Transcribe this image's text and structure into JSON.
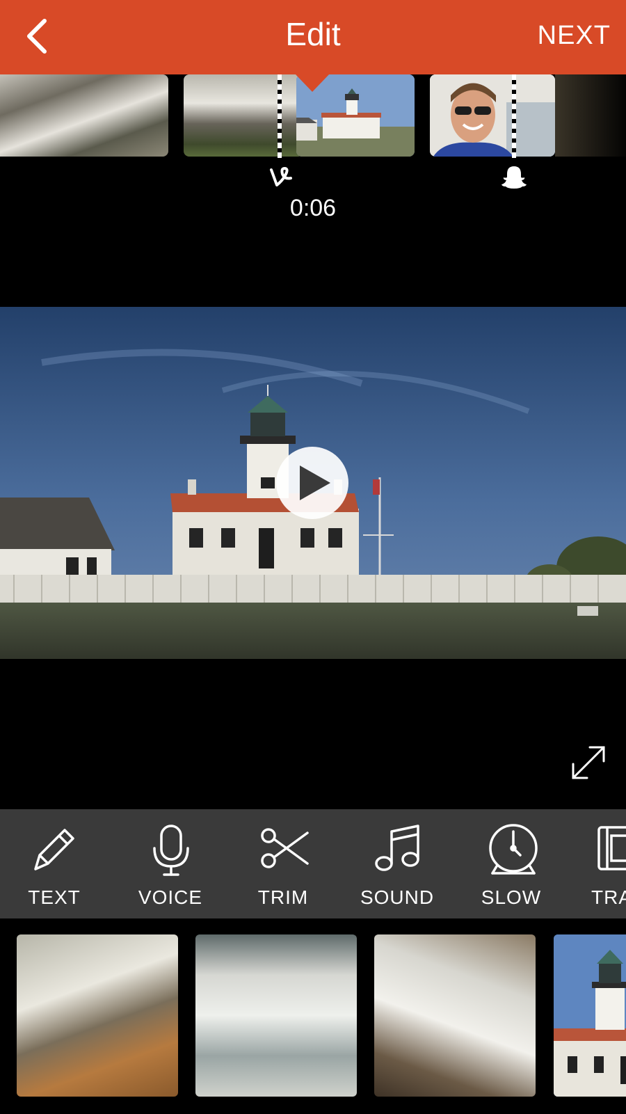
{
  "header": {
    "title": "Edit",
    "next_label": "NEXT",
    "back_icon": "chevron-left-icon",
    "color": "#d84a27"
  },
  "timeline": {
    "timecode": "0:06",
    "clips": [
      "clip-rocky-shore",
      "clip-crashing-waves",
      "clip-lighthouse",
      "clip-selfie"
    ],
    "markers": [
      "vine-icon",
      "snapchat-ghost-icon"
    ]
  },
  "preview": {
    "play_icon": "play-icon",
    "fullscreen_icon": "expand-icon"
  },
  "toolbar": {
    "background": "#3a3a3a",
    "tools": [
      {
        "label": "TEXT",
        "icon": "pencil-icon"
      },
      {
        "label": "VOICE",
        "icon": "microphone-icon"
      },
      {
        "label": "TRIM",
        "icon": "scissors-icon"
      },
      {
        "label": "SOUND",
        "icon": "music-note-icon"
      },
      {
        "label": "SLOW",
        "icon": "clock-icon"
      },
      {
        "label": "TRA",
        "icon": "filmstrip-icon"
      }
    ]
  },
  "library": {
    "thumbnails": [
      "thumb-waves-rocks",
      "thumb-surf",
      "thumb-cliff-waves",
      "thumb-lighthouse"
    ]
  }
}
